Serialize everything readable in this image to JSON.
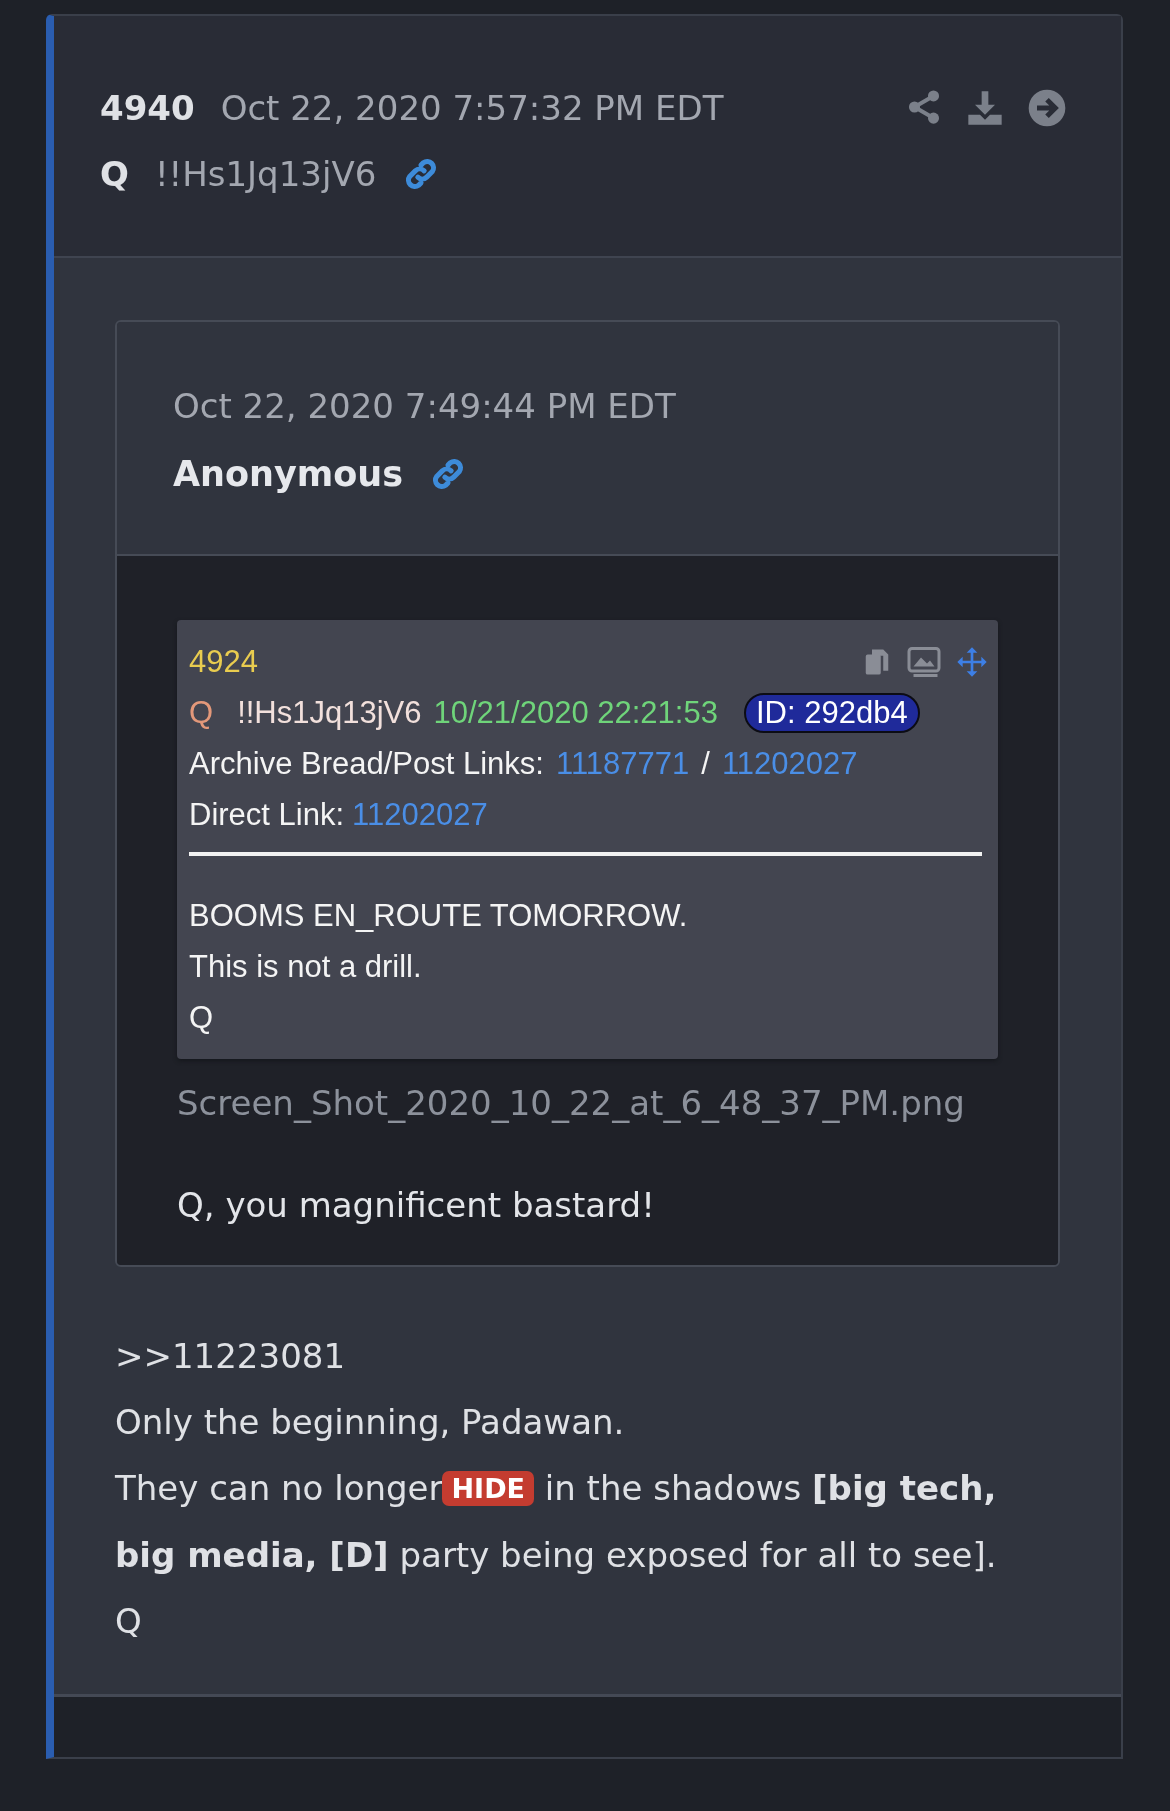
{
  "post": {
    "number": "4940",
    "date": "Oct 22, 2020 7:57:32 PM EDT",
    "author": "Q",
    "tripcode": "!!Hs1Jq13jV6"
  },
  "quote": {
    "date": "Oct 22, 2020 7:49:44 PM EDT",
    "author": "Anonymous",
    "screenshot": {
      "number": "4924",
      "author": "Q",
      "tripcode": "!!Hs1Jq13jV6",
      "timestamp": "10/21/2020 22:21:53",
      "id_badge": "ID: 292db4",
      "archive_label": "Archive Bread/Post Links:",
      "archive_links": [
        "11187771",
        "11202027"
      ],
      "separator": "/",
      "direct_label": "Direct Link:",
      "direct_link": "11202027",
      "lines": [
        "BOOMS EN_ROUTE TOMORROW.",
        "This is not a drill.",
        "Q"
      ]
    },
    "filename": "Screen_Shot_2020_10_22_at_6_48_37_PM.png",
    "text": "Q, you magnificent bastard!"
  },
  "body": [
    {
      "kind": "text",
      "text": ">>11223081"
    },
    {
      "kind": "text",
      "text": "Only the beginning, Padawan."
    },
    {
      "kind": "badge_line",
      "before": "They can no longer",
      "badge": "HIDE",
      "after": " in the shadows **[big tech, big media, [D]** party being exposed for all to see]."
    },
    {
      "kind": "text",
      "text": "Q"
    }
  ]
}
